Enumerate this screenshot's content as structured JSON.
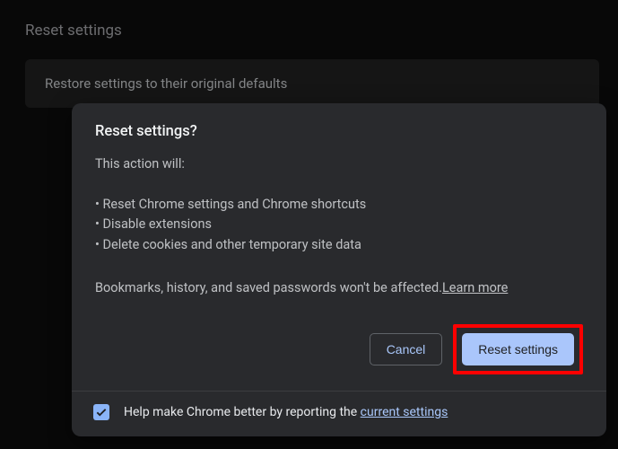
{
  "page": {
    "title": "Reset settings",
    "row_label": "Restore settings to their original defaults"
  },
  "dialog": {
    "title": "Reset settings?",
    "intro": "This action will:",
    "bullets": [
      "Reset Chrome settings and Chrome shortcuts",
      "Disable extensions",
      "Delete cookies and other temporary site data"
    ],
    "notice_prefix": "Bookmarks, history, and saved passwords won't be affected.",
    "learn_more": "Learn more",
    "cancel_label": "Cancel",
    "confirm_label": "Reset settings",
    "footer_text_prefix": "Help make Chrome better by reporting the ",
    "footer_link": "current settings",
    "checkbox_checked": true
  }
}
